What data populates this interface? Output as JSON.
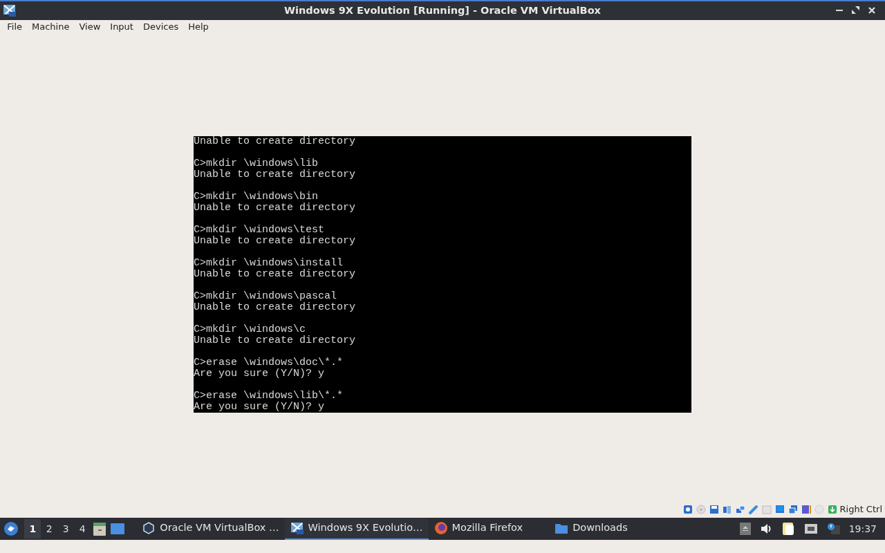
{
  "window": {
    "title": "Windows 9X Evolution [Running] - Oracle VM VirtualBox"
  },
  "menu": [
    "File",
    "Machine",
    "View",
    "Input",
    "Devices",
    "Help"
  ],
  "console": {
    "blocks": [
      [
        "Unable to create directory"
      ],
      [
        "C>mkdir \\windows\\lib",
        "Unable to create directory"
      ],
      [
        "C>mkdir \\windows\\bin",
        "Unable to create directory"
      ],
      [
        "C>mkdir \\windows\\test",
        "Unable to create directory"
      ],
      [
        "C>mkdir \\windows\\install",
        "Unable to create directory"
      ],
      [
        "C>mkdir \\windows\\pascal",
        "Unable to create directory"
      ],
      [
        "C>mkdir \\windows\\c",
        "Unable to create directory"
      ],
      [
        "C>erase \\windows\\doc\\*.*",
        "Are you sure (Y/N)? y"
      ],
      [
        "C>erase \\windows\\lib\\*.*",
        "Are you sure (Y/N)? y"
      ]
    ]
  },
  "status_bar": {
    "host_key": "Right Ctrl"
  },
  "taskbar": {
    "workspaces": [
      {
        "label": "1",
        "selected": true
      },
      {
        "label": "2",
        "selected": false
      },
      {
        "label": "3",
        "selected": false
      },
      {
        "label": "4",
        "selected": false
      }
    ],
    "tasks": [
      {
        "label": "Oracle VM VirtualBox …",
        "kind": "vbox",
        "selected": false
      },
      {
        "label": "Windows 9X Evolutio…",
        "kind": "vm",
        "selected": true
      },
      {
        "label": "Mozilla Firefox",
        "kind": "firefox",
        "selected": false
      },
      {
        "label": "Downloads",
        "kind": "folder",
        "selected": false
      }
    ],
    "clock": "19:37"
  }
}
